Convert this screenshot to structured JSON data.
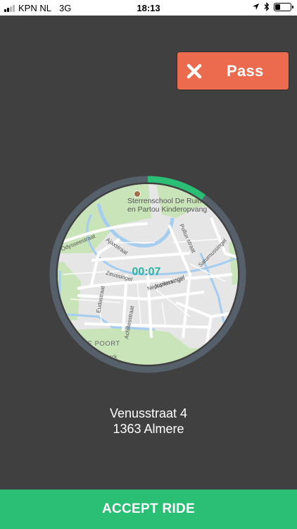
{
  "status_bar": {
    "carrier": "KPN NL",
    "network": "3G",
    "time": "18:13"
  },
  "pass_button": {
    "label": "Pass",
    "icon": "close-icon"
  },
  "map": {
    "timer": "00:07",
    "timer_progress": 0.1,
    "colors": {
      "progress": "#2abf74",
      "ring": "#56606a",
      "timer": "#2bb5a2"
    },
    "poi": "Sterrenschool De Ruim",
    "poi_line2": "en Partou Kinderopvang",
    "streets": [
      "Odysseestraat",
      "Ajaxstraat",
      "Zeussingel",
      "Jupitersingel",
      "Neptunussingel",
      "Pollux straat",
      "Saturnussingel",
      "Eudastraat",
      "Achillesstraat"
    ],
    "area_label": "MERE POORT",
    "park_label": "Park"
  },
  "address": {
    "line1": "Venusstraat 4",
    "line2": "1363 Almere"
  },
  "accept_button": {
    "label": "ACCEPT RIDE"
  },
  "colors": {
    "background": "#404040",
    "pass": "#ec6a4d",
    "accept": "#2abf74"
  }
}
